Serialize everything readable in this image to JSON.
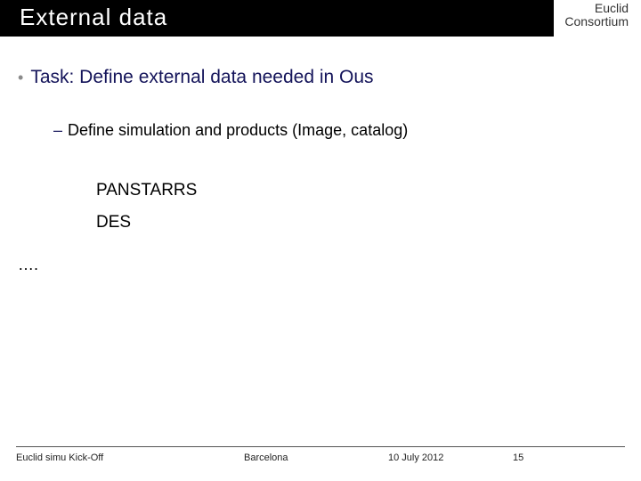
{
  "header": {
    "title": "External data",
    "brand_line1": "Euclid",
    "brand_line2": "Consortium"
  },
  "main": {
    "bullet": "Task: Define external data needed in Ous",
    "sub_bullet": "Define simulation and products (Image, catalog)",
    "item1": "PANSTARRS",
    "item2": "DES",
    "ellipsis": "…."
  },
  "footer": {
    "left": "Euclid simu Kick-Off",
    "place": "Barcelona",
    "date": "10 July 2012",
    "page": "15"
  }
}
